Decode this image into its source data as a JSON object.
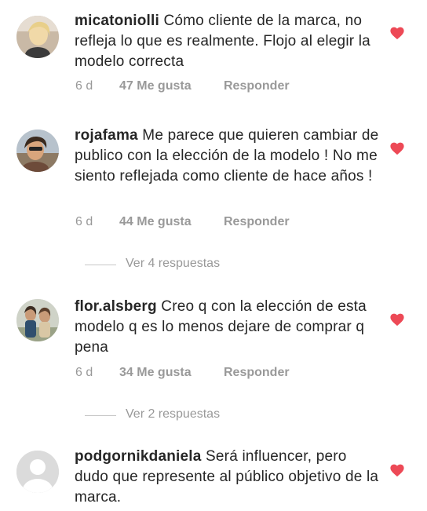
{
  "comments": [
    {
      "username": "micatoniolli",
      "text": " Cómo cliente de la marca, no refleja lo que es realmente. Flojo al elegir la modelo correcta",
      "time": "6 d",
      "likes": "47 Me gusta",
      "reply": "Responder",
      "liked": true,
      "heart_color": "#ed4956",
      "avatar_icon": "profile-photo"
    },
    {
      "username": "rojafama",
      "text": " Me parece que quieren cambiar de publico con la elección de la modelo ! No me siento reflejada como cliente de hace años !",
      "time": "6 d",
      "likes": "44 Me gusta",
      "reply": "Responder",
      "liked": true,
      "heart_color": "#ed4956",
      "avatar_icon": "profile-photo",
      "view_replies": "Ver 4 respuestas"
    },
    {
      "username": "flor.alsberg",
      "text": " Creo q con la elección de esta modelo q es lo menos dejare de comprar q pena",
      "time": "6 d",
      "likes": "34 Me gusta",
      "reply": "Responder",
      "liked": true,
      "heart_color": "#ed4956",
      "avatar_icon": "profile-photo",
      "view_replies": "Ver 2 respuestas"
    },
    {
      "username": "podgornikdaniela",
      "text": " Será influencer, pero dudo que represente al público objetivo de la marca.",
      "liked": true,
      "heart_color": "#ed4956",
      "avatar_icon": "default-avatar"
    }
  ]
}
